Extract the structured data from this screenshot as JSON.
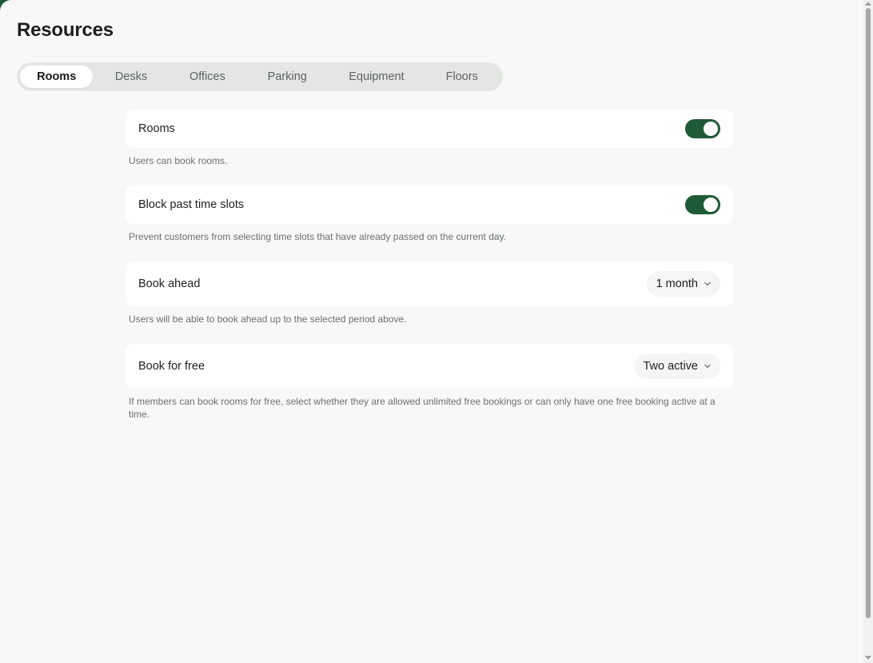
{
  "page": {
    "title": "Resources"
  },
  "tabs": [
    {
      "label": "Rooms",
      "active": true
    },
    {
      "label": "Desks",
      "active": false
    },
    {
      "label": "Offices",
      "active": false
    },
    {
      "label": "Parking",
      "active": false
    },
    {
      "label": "Equipment",
      "active": false
    },
    {
      "label": "Floors",
      "active": false
    }
  ],
  "settings": {
    "rooms": {
      "label": "Rooms",
      "enabled": true,
      "description": "Users can book rooms."
    },
    "block_past": {
      "label": "Block past time slots",
      "enabled": true,
      "description": "Prevent customers from selecting time slots that have already passed on the current day."
    },
    "book_ahead": {
      "label": "Book ahead",
      "value": "1 month",
      "description": "Users will be able to book ahead up to the selected period above."
    },
    "book_free": {
      "label": "Book for free",
      "value": "Two active",
      "description": "If members can book rooms for free, select whether they are allowed unlimited free bookings or can only have one free booking active at a time."
    }
  },
  "icons": {
    "dropdown": "chevron-down-icon"
  },
  "colors": {
    "accent": "#1e5a36",
    "background": "#f8f8f8",
    "card": "#ffffff",
    "tab_track": "#e4e6e4",
    "muted_text": "#6a716d"
  }
}
